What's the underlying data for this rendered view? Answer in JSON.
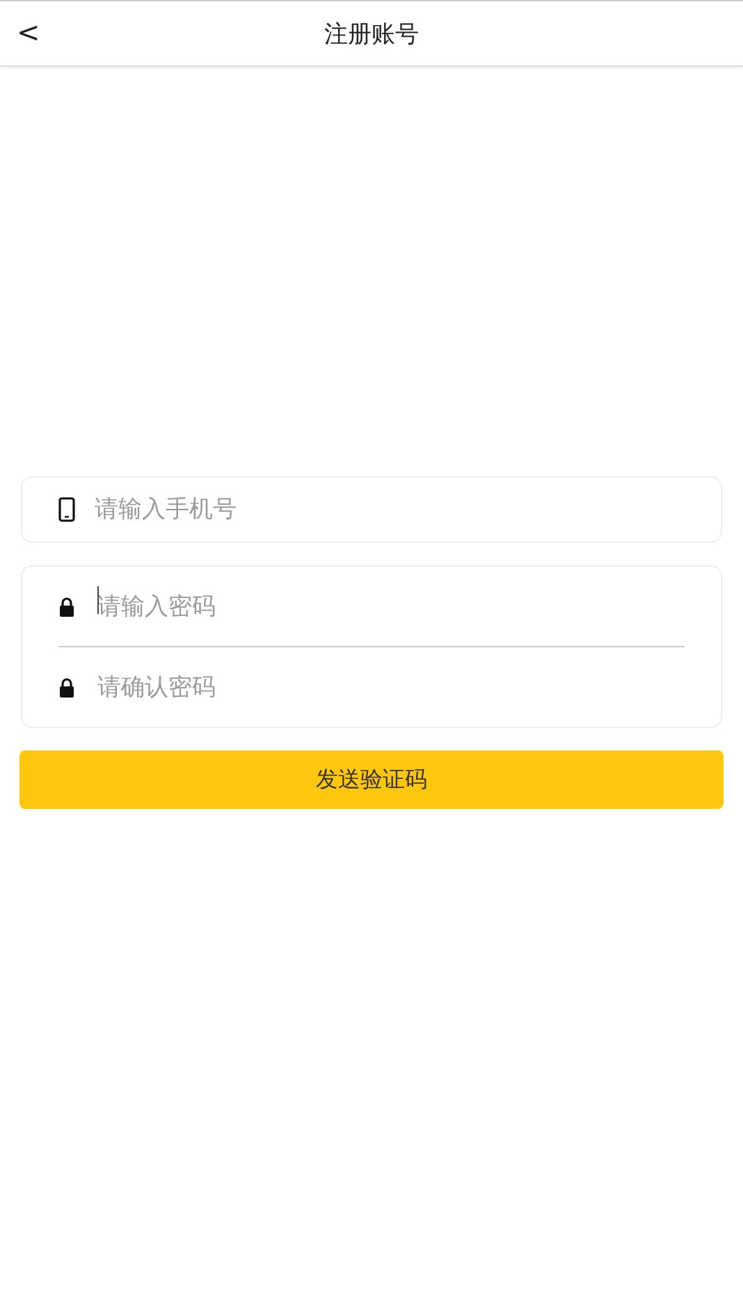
{
  "header": {
    "back": "<",
    "title": "注册账号"
  },
  "cards": [
    {
      "fields": [
        {
          "kind": "phone",
          "placeholder": "请输入手机号",
          "focused": false
        }
      ]
    },
    {
      "fields": [
        {
          "kind": "lock",
          "placeholder": "请输入密码",
          "focused": true
        },
        {
          "kind": "lock",
          "placeholder": "请确认密码",
          "focused": false
        }
      ]
    }
  ],
  "submit": "发送验证码"
}
